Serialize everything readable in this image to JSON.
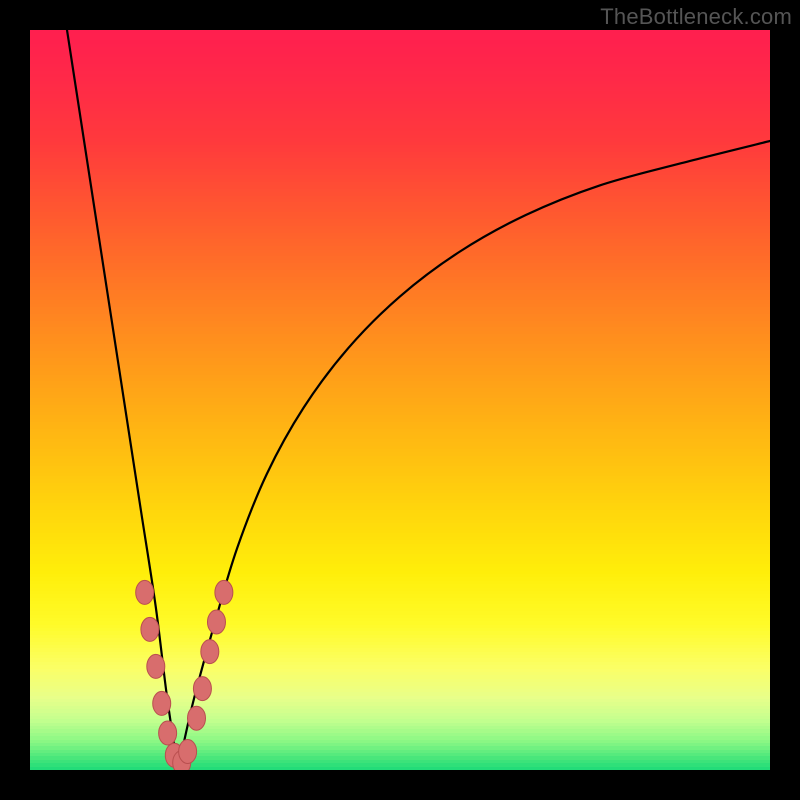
{
  "attribution": "TheBottleneck.com",
  "colors": {
    "frame": "#000000",
    "curve": "#000000",
    "dots": "#d86d6d",
    "dot_stroke": "#b94f4f"
  },
  "chart_data": {
    "type": "line",
    "title": "",
    "xlabel": "",
    "ylabel": "",
    "xlim": [
      0,
      100
    ],
    "ylim": [
      0,
      100
    ],
    "grid": false,
    "legend": false,
    "note": "V-shaped bottleneck curve; minimum (optimal match) near x≈20. Left branch descends from top-left corner to the minimum; right branch ascends asymptotically toward y≈85 at the right edge. Background is a vertical green→yellow→red gradient indicating severity.",
    "optimum_x": 20,
    "series": [
      {
        "name": "left-branch",
        "x": [
          5,
          7,
          9,
          11,
          13,
          15,
          17,
          18.5,
          20
        ],
        "y": [
          100,
          87,
          74,
          61,
          48,
          35,
          22,
          10,
          0
        ]
      },
      {
        "name": "right-branch",
        "x": [
          20,
          22,
          25,
          28,
          32,
          37,
          43,
          50,
          58,
          67,
          77,
          88,
          100
        ],
        "y": [
          0,
          9,
          20,
          30,
          40,
          49,
          57,
          64,
          70,
          75,
          79,
          82,
          85
        ]
      }
    ],
    "dots": [
      {
        "x": 15.5,
        "y": 24
      },
      {
        "x": 16.2,
        "y": 19
      },
      {
        "x": 17.0,
        "y": 14
      },
      {
        "x": 17.8,
        "y": 9
      },
      {
        "x": 18.6,
        "y": 5
      },
      {
        "x": 19.5,
        "y": 2
      },
      {
        "x": 20.5,
        "y": 1
      },
      {
        "x": 21.3,
        "y": 2.5
      },
      {
        "x": 22.5,
        "y": 7
      },
      {
        "x": 23.3,
        "y": 11
      },
      {
        "x": 24.3,
        "y": 16
      },
      {
        "x": 25.2,
        "y": 20
      },
      {
        "x": 26.2,
        "y": 24
      }
    ],
    "gradient_stops": [
      {
        "pos": 0.0,
        "color": "#ff1f4f"
      },
      {
        "pos": 0.07,
        "color": "#ff2a47"
      },
      {
        "pos": 0.15,
        "color": "#ff3a3c"
      },
      {
        "pos": 0.25,
        "color": "#ff5a2f"
      },
      {
        "pos": 0.35,
        "color": "#ff7a24"
      },
      {
        "pos": 0.45,
        "color": "#ff9a1a"
      },
      {
        "pos": 0.55,
        "color": "#ffb912"
      },
      {
        "pos": 0.65,
        "color": "#ffd70c"
      },
      {
        "pos": 0.73,
        "color": "#ffee0a"
      },
      {
        "pos": 0.8,
        "color": "#fffb28"
      },
      {
        "pos": 0.86,
        "color": "#fbff66"
      },
      {
        "pos": 0.9,
        "color": "#e8ff8a"
      },
      {
        "pos": 0.93,
        "color": "#c4ff8f"
      },
      {
        "pos": 0.96,
        "color": "#88f784"
      },
      {
        "pos": 0.985,
        "color": "#3fe47a"
      },
      {
        "pos": 1.0,
        "color": "#17d978"
      }
    ]
  }
}
